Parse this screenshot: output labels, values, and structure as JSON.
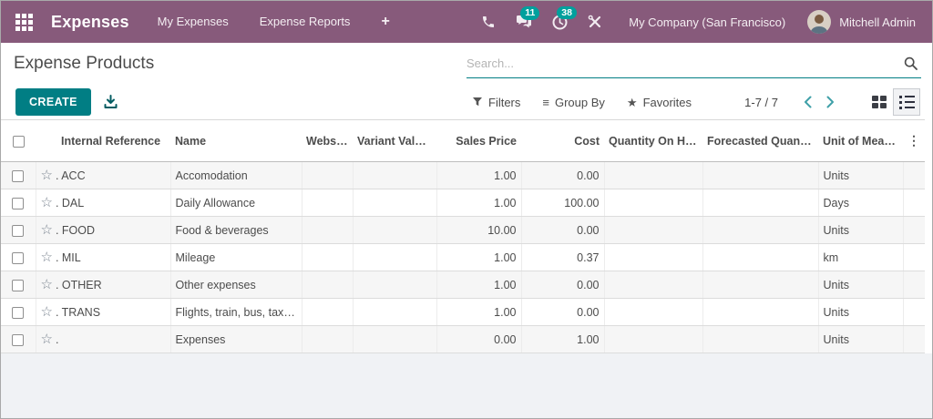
{
  "colors": {
    "navbar_bg": "#875A7B",
    "accent": "#017E84",
    "badge": "#00A09D",
    "stripe": "#f6f6f6",
    "filler_bg": "#f0f2f5"
  },
  "navbar": {
    "app_name": "Expenses",
    "menus": [
      {
        "label": "My Expenses"
      },
      {
        "label": "Expense Reports"
      },
      {
        "label": "+"
      }
    ],
    "systray": {
      "messages_count": "11",
      "activities_count": "38",
      "company": "My Company (San Francisco)",
      "user": "Mitchell Admin"
    }
  },
  "control_panel": {
    "breadcrumb": "Expense Products",
    "search": {
      "placeholder": "Search..."
    },
    "create_label": "CREATE",
    "filters_label": "Filters",
    "groupby_label": "Group By",
    "favorites_label": "Favorites",
    "pager": {
      "display": "1-7 / 7",
      "value": "1-7",
      "total": "7"
    }
  },
  "icons": {
    "row_star": "☆",
    "favorites_star": "★",
    "groupby_lines": "≡",
    "options_dots": "⋮"
  },
  "table": {
    "columns": [
      "Internal Reference",
      "Name",
      "Website",
      "Variant Valu…",
      "Sales Price",
      "Cost",
      "Quantity On Ha…",
      "Forecasted Quantity",
      "Unit of Measure"
    ],
    "rows": [
      {
        "ref": "ACC",
        "ref_display": ". ACC",
        "name": "Accomodation",
        "website": "",
        "variant_values": "",
        "sales_price": "1.00",
        "cost": "0.00",
        "qty_on_hand": "",
        "forecasted_qty": "",
        "uom": "Units"
      },
      {
        "ref": "DAL",
        "ref_display": ". DAL",
        "name": "Daily Allowance",
        "website": "",
        "variant_values": "",
        "sales_price": "1.00",
        "cost": "100.00",
        "qty_on_hand": "",
        "forecasted_qty": "",
        "uom": "Days"
      },
      {
        "ref": "FOOD",
        "ref_display": ". FOOD",
        "name": "Food & beverages",
        "website": "",
        "variant_values": "",
        "sales_price": "10.00",
        "cost": "0.00",
        "qty_on_hand": "",
        "forecasted_qty": "",
        "uom": "Units"
      },
      {
        "ref": "MIL",
        "ref_display": ". MIL",
        "name": "Mileage",
        "website": "",
        "variant_values": "",
        "sales_price": "1.00",
        "cost": "0.37",
        "qty_on_hand": "",
        "forecasted_qty": "",
        "uom": "km"
      },
      {
        "ref": "OTHER",
        "ref_display": ". OTHER",
        "name": "Other expenses",
        "website": "",
        "variant_values": "",
        "sales_price": "1.00",
        "cost": "0.00",
        "qty_on_hand": "",
        "forecasted_qty": "",
        "uom": "Units"
      },
      {
        "ref": "TRANS",
        "ref_display": ". TRANS",
        "name": "Flights, train, bus, taxi,…",
        "website": "",
        "variant_values": "",
        "sales_price": "1.00",
        "cost": "0.00",
        "qty_on_hand": "",
        "forecasted_qty": "",
        "uom": "Units"
      },
      {
        "ref": "",
        "ref_display": ".",
        "name": "Expenses",
        "website": "",
        "variant_values": "",
        "sales_price": "0.00",
        "cost": "1.00",
        "qty_on_hand": "",
        "forecasted_qty": "",
        "uom": "Units"
      }
    ]
  }
}
